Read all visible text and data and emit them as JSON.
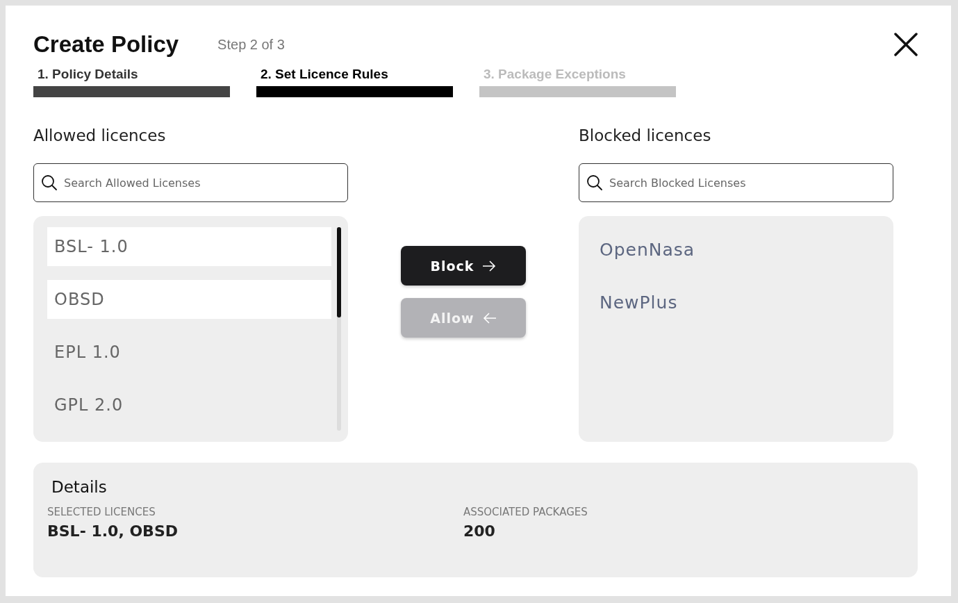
{
  "dialog": {
    "title": "Create Policy",
    "step_label": "Step 2 of 3"
  },
  "steps": [
    {
      "label": "1. Policy Details",
      "completed": true,
      "selected": false
    },
    {
      "label": "2. Set Licence Rules",
      "completed": false,
      "selected": true
    },
    {
      "label": "3. Package Exceptions",
      "completed": false,
      "selected": false
    }
  ],
  "allowed": {
    "heading": "Allowed licences",
    "search": {
      "placeholder": "Search Allowed Licenses"
    },
    "items": [
      {
        "label": "BSL- 1.0",
        "selected": true
      },
      {
        "label": "OBSD",
        "selected": true
      },
      {
        "label": "EPL 1.0",
        "selected": false
      },
      {
        "label": "GPL 2.0",
        "selected": false
      }
    ]
  },
  "actions": [
    {
      "label": "Block",
      "kind": "right",
      "disabled": false
    },
    {
      "label": "Allow",
      "kind": "left",
      "disabled": true
    }
  ],
  "blocked": {
    "heading": "Blocked licences",
    "search": {
      "placeholder": "Search Blocked Licenses"
    },
    "items": [
      {
        "label": "OpenNasa",
        "selected": false
      },
      {
        "label": "NewPlus",
        "selected": false
      }
    ]
  },
  "details": {
    "heading": "Details",
    "fields": [
      {
        "label": "SELECTED LICENCES",
        "value": "BSL- 1.0, OBSD"
      },
      {
        "label": "ASSOCIATED PACKAGES",
        "value": "200"
      }
    ]
  }
}
